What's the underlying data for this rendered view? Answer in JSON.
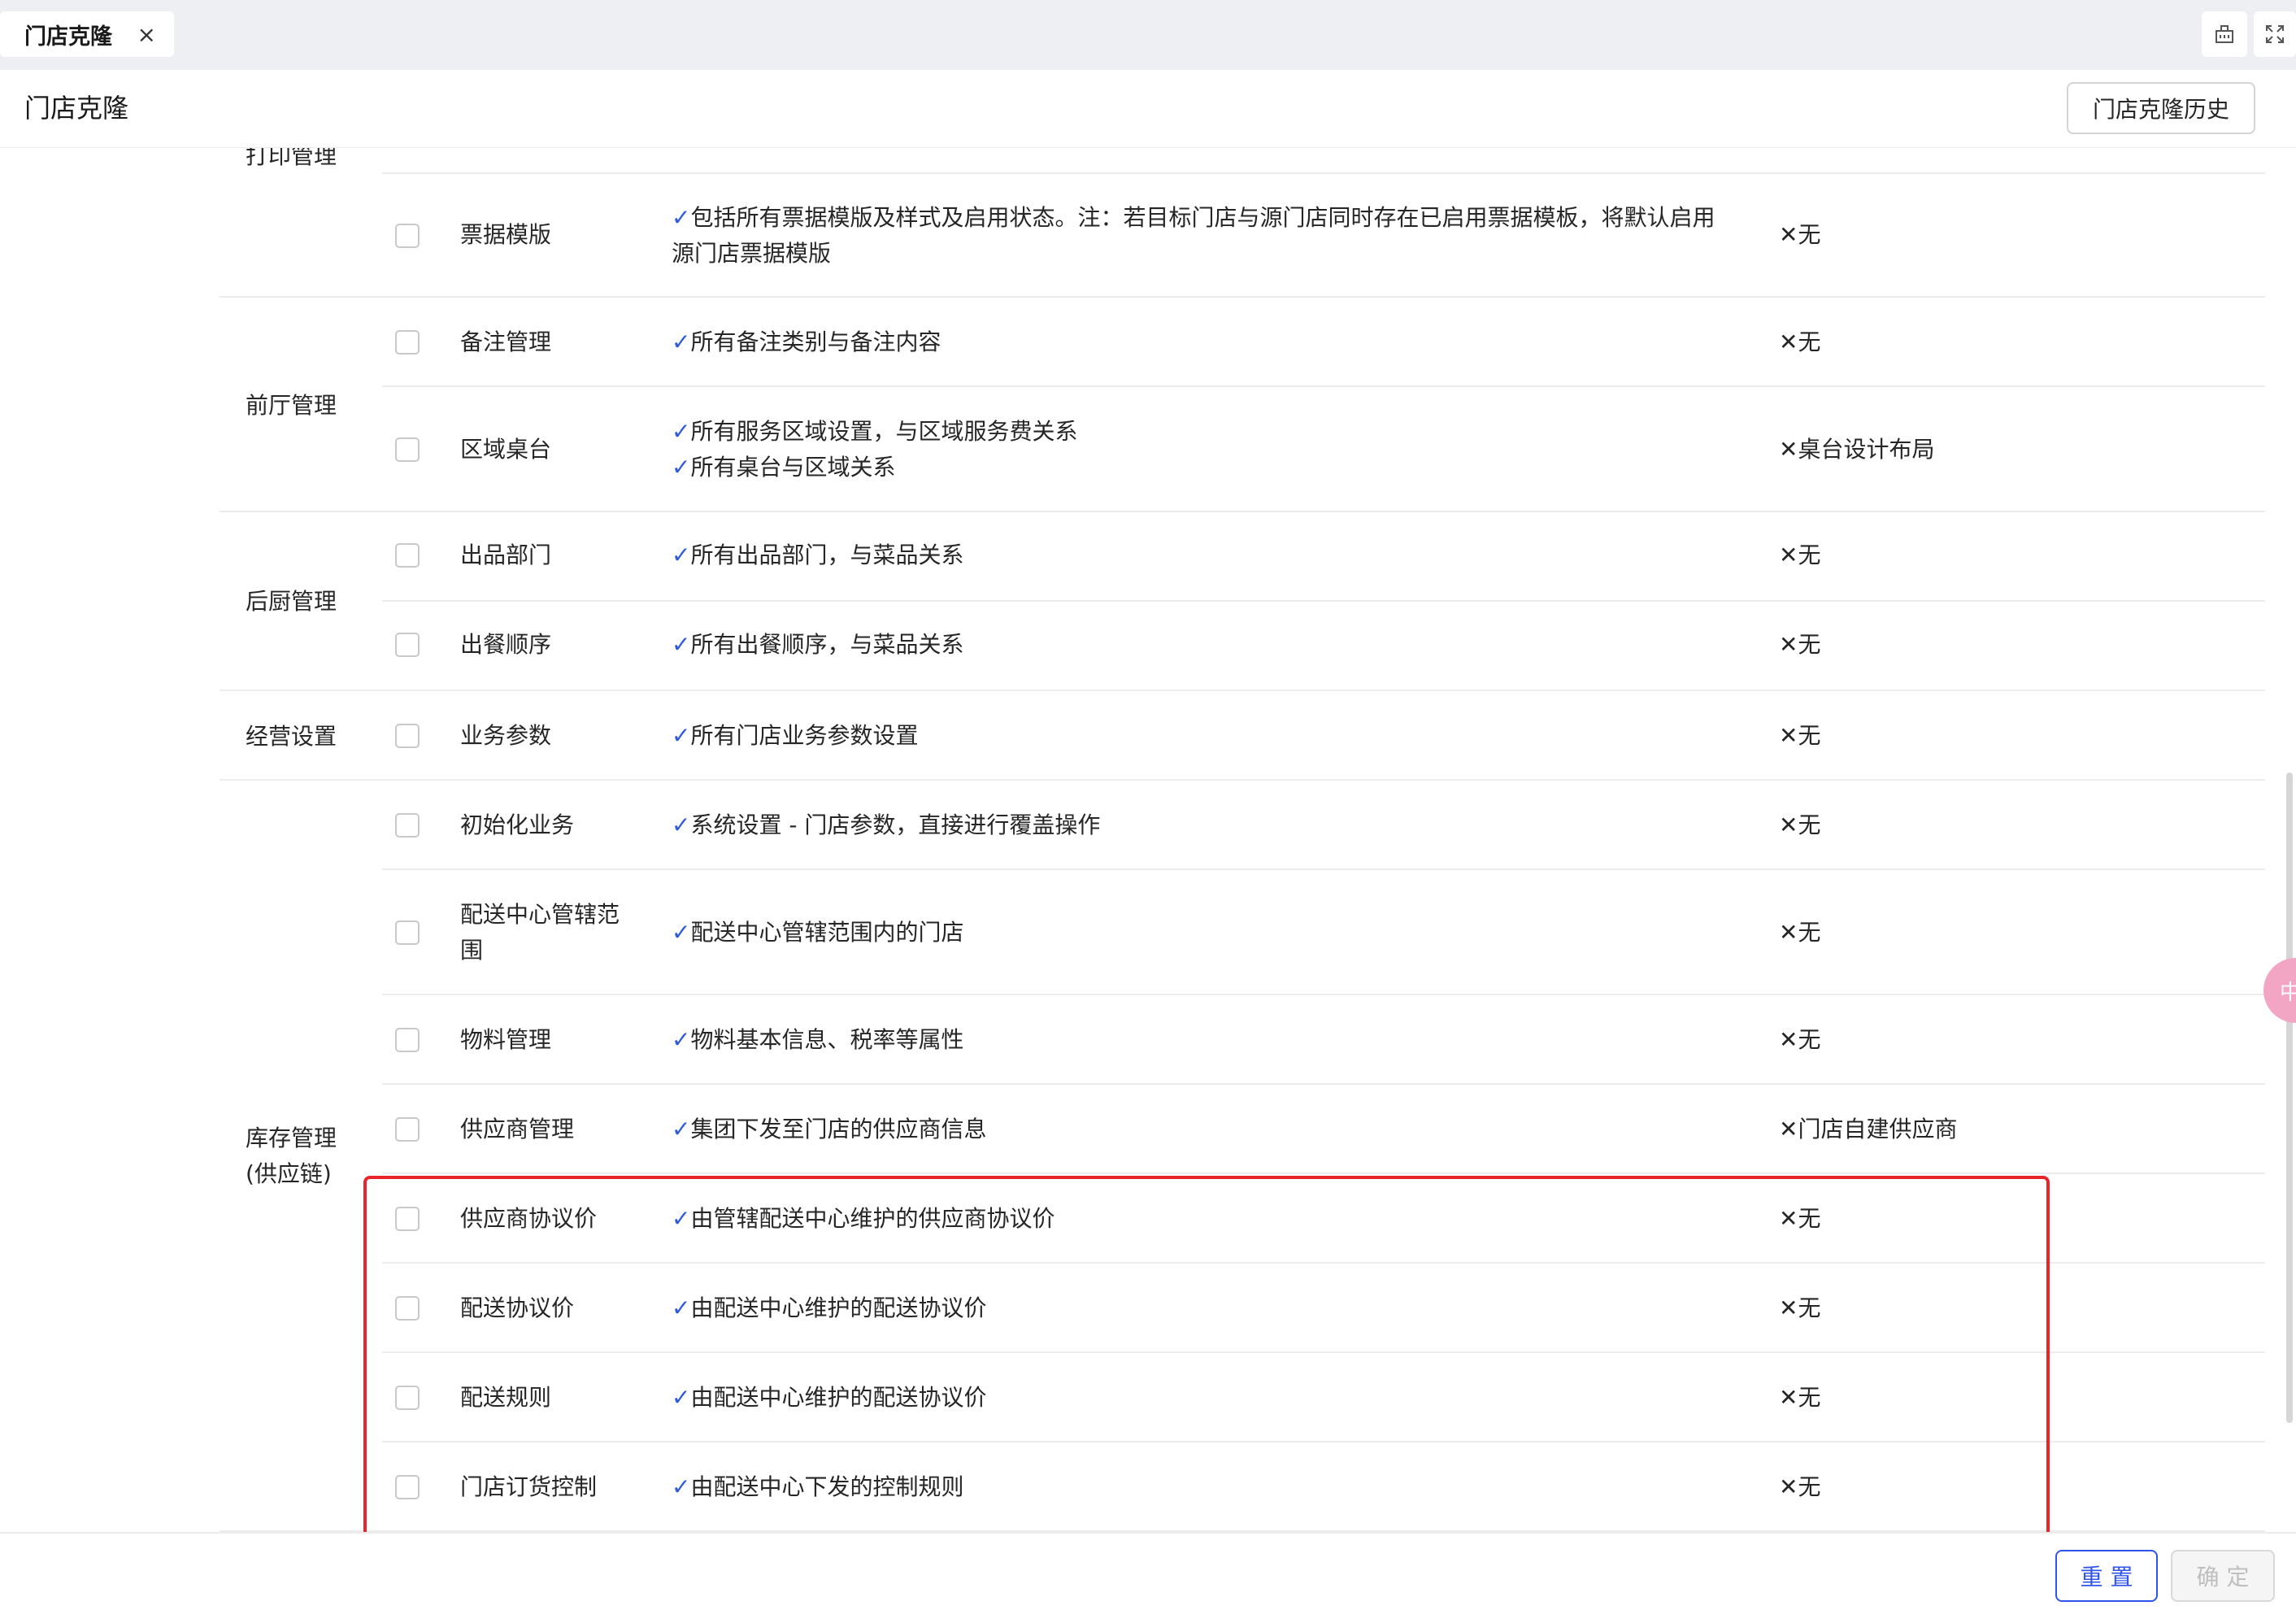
{
  "tab": {
    "title": "门店克隆",
    "close_glyph": "×"
  },
  "tabbar_icons": [
    "building-icon",
    "fullscreen-icon"
  ],
  "header": {
    "title": "门店克隆",
    "history_button": "门店克隆历史"
  },
  "groups": [
    {
      "label": "打印管理"
    },
    {
      "label": "前厅管理"
    },
    {
      "label": "后厨管理"
    },
    {
      "label": "经营设置"
    },
    {
      "label_line1": "库存管理",
      "label_line2": "(供应链)"
    }
  ],
  "rows": [
    {
      "name": "票据模版",
      "desc": [
        "✓包括所有票据模版及样式及启用状态。注：若目标门店与源门店同时存在已启用票据模板，将默认启用源门店票据模版"
      ],
      "excluded": "✕无",
      "checked": false
    },
    {
      "name": "备注管理",
      "desc": [
        "✓所有备注类别与备注内容"
      ],
      "excluded": "✕无",
      "checked": false
    },
    {
      "name": "区域桌台",
      "desc": [
        "✓所有服务区域设置，与区域服务费关系",
        "✓所有桌台与区域关系"
      ],
      "excluded": "✕桌台设计布局",
      "checked": false
    },
    {
      "name": "出品部门",
      "desc": [
        "✓所有出品部门，与菜品关系"
      ],
      "excluded": "✕无",
      "checked": false
    },
    {
      "name": "出餐顺序",
      "desc": [
        "✓所有出餐顺序，与菜品关系"
      ],
      "excluded": "✕无",
      "checked": false
    },
    {
      "name": "业务参数",
      "desc": [
        "✓所有门店业务参数设置"
      ],
      "excluded": "✕无",
      "checked": false
    },
    {
      "name": "初始化业务",
      "desc": [
        "✓系统设置 - 门店参数，直接进行覆盖操作"
      ],
      "excluded": "✕无",
      "checked": false
    },
    {
      "name_line1": "配送中心管辖范",
      "name_line2": "围",
      "desc": [
        "✓配送中心管辖范围内的门店"
      ],
      "excluded": "✕无",
      "checked": false
    },
    {
      "name": "物料管理",
      "desc": [
        "✓物料基本信息、税率等属性"
      ],
      "excluded": "✕无",
      "checked": false
    },
    {
      "name": "供应商管理",
      "desc": [
        "✓集团下发至门店的供应商信息"
      ],
      "excluded": "✕门店自建供应商",
      "checked": false
    },
    {
      "name": "供应商协议价",
      "desc": [
        "✓由管辖配送中心维护的供应商协议价"
      ],
      "excluded": "✕无",
      "checked": false
    },
    {
      "name": "配送协议价",
      "desc": [
        "✓由配送中心维护的配送协议价"
      ],
      "excluded": "✕无",
      "checked": false
    },
    {
      "name": "配送规则",
      "desc": [
        "✓由配送中心维护的配送协议价"
      ],
      "excluded": "✕无",
      "checked": false
    },
    {
      "name": "门店订货控制",
      "desc": [
        "✓由配送中心下发的控制规则"
      ],
      "excluded": "✕无",
      "checked": false
    }
  ],
  "float_button": "中",
  "footer": {
    "reset": "重 置",
    "confirm": "确 定"
  },
  "colors": {
    "accent": "#2f54eb",
    "check": "#2f5bd8",
    "highlight_border": "#e8252b"
  }
}
